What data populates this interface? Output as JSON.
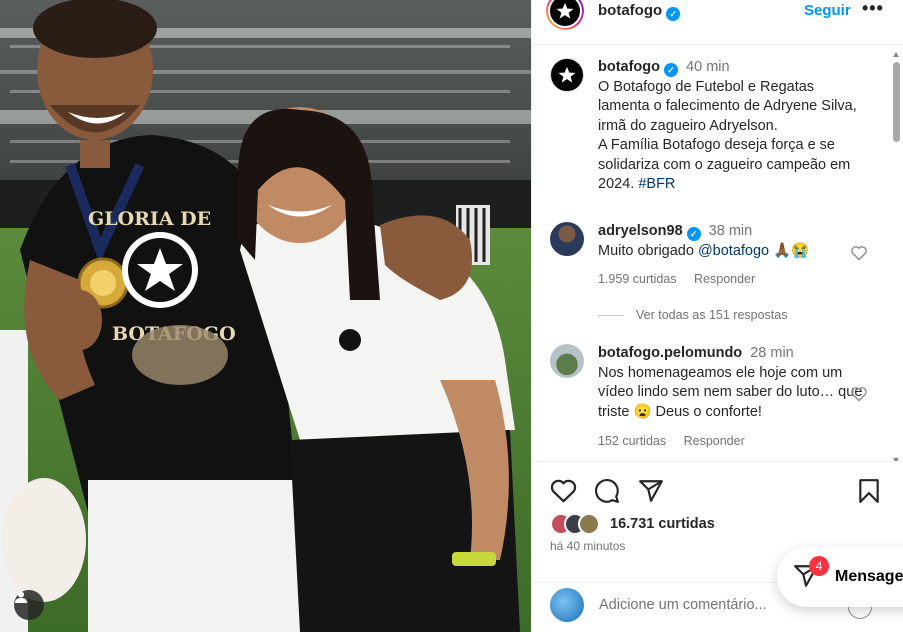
{
  "post": {
    "username": "botafogo",
    "follow_label": "Seguir",
    "more_label": "•••"
  },
  "caption": {
    "username": "botafogo",
    "time": "40 min",
    "text": "O Botafogo de Futebol e Regatas lamenta o falecimento de Adryene Silva, irmã do zagueiro Adryelson.\nA Família Botafogo deseja força e se solidariza com o zagueiro campeão em 2024.",
    "hashtag": "#BFR"
  },
  "comments": [
    {
      "username": "adryelson98",
      "time": "38 min",
      "text": "Muito obrigado",
      "mention": "@botafogo",
      "emoji": "🙏🏾😭",
      "likes": "1.959 curtidas",
      "reply_label": "Responder"
    },
    {
      "username": "botafogo.pelomundo",
      "time": "28 min",
      "text": "Nos homenageamos ele hoje com um vídeo lindo sem nem saber do luto… que triste 😦 Deus o conforte!",
      "likes": "152 curtidas",
      "reply_label": "Responder"
    }
  ],
  "view_replies": "Ver todas as 151 respostas",
  "likes_total": "16.731 curtidas",
  "posted_ago": "há 40 minutos",
  "add_comment_placeholder": "Adicione um comentário...",
  "messages": {
    "label": "Mensagens",
    "badge": "4"
  },
  "photo_shirt_text": "GLORIA DE BOTAFOGO",
  "colors": {
    "accent": "#0095f6",
    "link": "#00376b",
    "badge": "#ff3040"
  }
}
